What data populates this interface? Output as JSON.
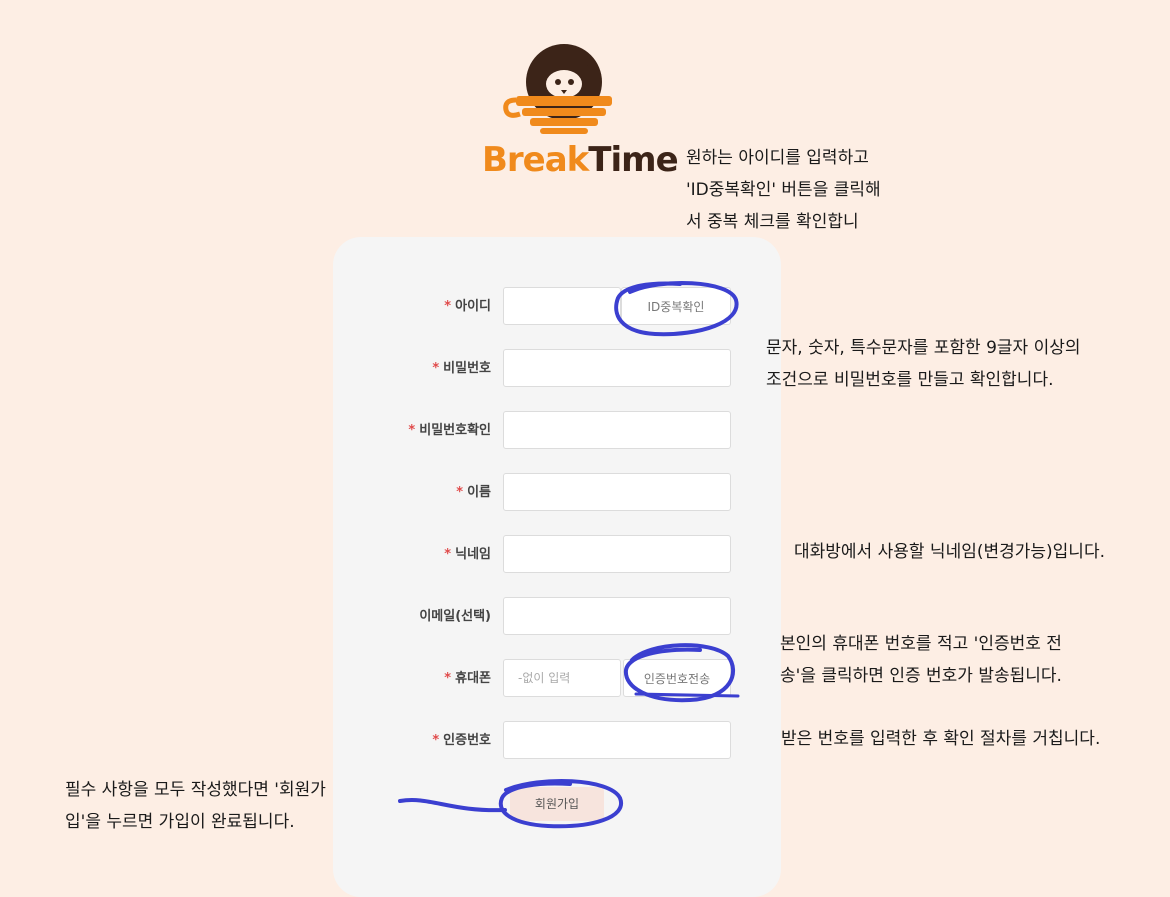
{
  "brand": {
    "part1": "Break",
    "part2": "Time"
  },
  "form": {
    "required_mark": "*",
    "fields": {
      "id": {
        "label": "아이디",
        "value": "",
        "placeholder": ""
      },
      "password": {
        "label": "비밀번호",
        "value": "",
        "placeholder": ""
      },
      "password_confirm": {
        "label": "비밀번호확인",
        "value": "",
        "placeholder": ""
      },
      "name": {
        "label": "이름",
        "value": "",
        "placeholder": ""
      },
      "nickname": {
        "label": "닉네임",
        "value": "",
        "placeholder": ""
      },
      "email": {
        "label": "이메일(선택)",
        "value": "",
        "placeholder": ""
      },
      "phone": {
        "label": "휴대폰",
        "value": "",
        "placeholder": "-없이 입력"
      },
      "auth_code": {
        "label": "인증번호",
        "value": "",
        "placeholder": ""
      }
    },
    "id_check_button": "ID중복확인",
    "send_code_button": "인증번호전송",
    "submit_button": "회원가입"
  },
  "annotations": {
    "id_note": "원하는 아이디를 입력하고\n'ID중복확인' 버튼을 클릭해\n서 중복 체크를 확인합니",
    "password_note": "문자, 숫자, 특수문자를 포함한 9글자 이상의\n조건으로 비밀번호를 만들고 확인합니다.",
    "nickname_note": "대화방에서 사용할 닉네임(변경가능)입니다.",
    "phone_note": "본인의 휴대폰 번호를 적고 '인증번호 전\n송'을 클릭하면 인증 번호가 발송됩니다.",
    "auth_note": "받은 번호를 입력한 후 확인 절차를 거칩니다.",
    "submit_note": "필수 사항을 모두 작성했다면 '회원가\n입'을 누르면 가입이 완료됩니다."
  },
  "colors": {
    "background": "#fdeee4",
    "brand_orange": "#f08a1c",
    "brand_brown": "#3c2418",
    "annotation_stroke": "#3b3fd0",
    "required": "#e04b4b"
  }
}
